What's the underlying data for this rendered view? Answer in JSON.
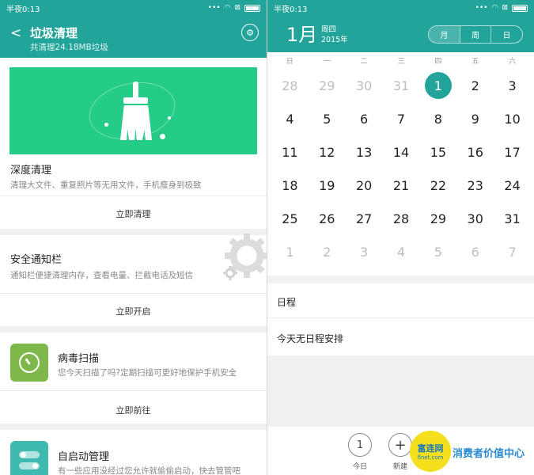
{
  "left": {
    "status": {
      "time": "半夜0:13"
    },
    "header": {
      "title": "垃圾清理",
      "subtitle": "共清理24.18MB垃圾"
    },
    "cards": [
      {
        "title": "深度清理",
        "desc": "清理大文件、重复照片等无用文件，手机瘦身到极致",
        "action": "立即清理"
      },
      {
        "title": "安全通知栏",
        "desc": "通知栏便捷清理内存，查看电量、拦截电话及短信",
        "action": "立即开启"
      },
      {
        "title": "病毒扫描",
        "desc": "您今天扫描了吗?定期扫描可更好地保护手机安全",
        "action": "立即前往"
      },
      {
        "title": "自启动管理",
        "desc": "有一些应用没经过您允许就偷偷启动，快去管管吧"
      }
    ]
  },
  "right": {
    "status": {
      "time": "半夜0:13"
    },
    "header": {
      "month": "1月",
      "weekday": "周四",
      "year": "2015年"
    },
    "view_tabs": [
      "月",
      "周",
      "日"
    ],
    "weekday_headers": [
      "日",
      "一",
      "二",
      "三",
      "四",
      "五",
      "六"
    ],
    "weeks": [
      [
        "28",
        "29",
        "30",
        "31",
        "1",
        "2",
        "3"
      ],
      [
        "4",
        "5",
        "6",
        "7",
        "8",
        "9",
        "10"
      ],
      [
        "11",
        "12",
        "13",
        "14",
        "15",
        "16",
        "17"
      ],
      [
        "18",
        "19",
        "20",
        "21",
        "22",
        "23",
        "24"
      ],
      [
        "25",
        "26",
        "27",
        "28",
        "29",
        "30",
        "31"
      ],
      [
        "1",
        "2",
        "3",
        "4",
        "5",
        "6",
        "7"
      ]
    ],
    "selected_day": "1",
    "schedule": {
      "heading": "日程",
      "empty_text": "今天无日程安排"
    },
    "bottom": {
      "today_icon": "1",
      "today_label": "今日",
      "new_icon": "+",
      "new_label": "新建"
    }
  },
  "watermark": {
    "logo_cn": "富连网",
    "logo_en": "flnet.com",
    "text": "消费者价值中心"
  },
  "colors": {
    "accent": "#23a49a",
    "banner": "#25cc88",
    "virus_icon": "#7fb84a",
    "autostart_icon": "#3fbab0",
    "watermark_bg": "#f5df1c"
  },
  "icons": [
    "back-arrow-icon",
    "settings-gear-icon",
    "wifi-icon",
    "battery-icon",
    "broom-icon",
    "gear-icon",
    "timer-icon",
    "toggle-switches-icon",
    "plus-icon"
  ]
}
